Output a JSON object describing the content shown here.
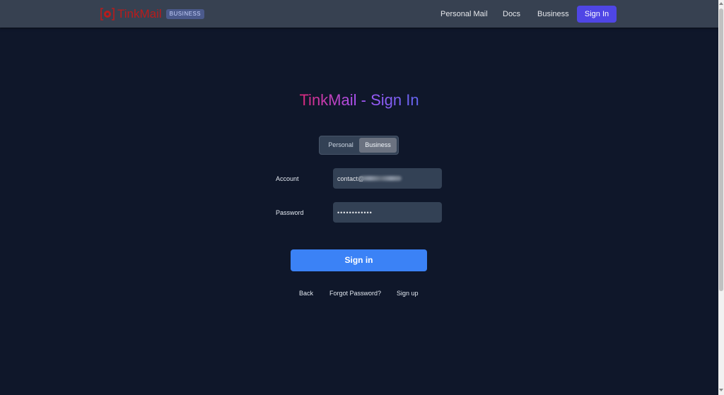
{
  "header": {
    "brand": "TinkMail",
    "badge": "BUSINESS",
    "nav": {
      "personal_mail": "Personal Mail",
      "docs": "Docs",
      "business": "Business"
    },
    "signin_button": "Sign In"
  },
  "main": {
    "title": "TinkMail - Sign In",
    "toggle": {
      "personal": "Personal",
      "business": "Business",
      "selected": "Business"
    },
    "account": {
      "label": "Account",
      "value": "contact@"
    },
    "password": {
      "label": "Password",
      "value": "••••••••••••"
    },
    "submit_label": "Sign in",
    "links": {
      "back": "Back",
      "forgot": "Forgot Password?",
      "signup": "Sign up"
    }
  },
  "colors": {
    "background": "#0f172a",
    "header": "#374151",
    "primary": "#3b82f6",
    "nav_button": "#4f46e5",
    "brand": "#b91c1c"
  }
}
